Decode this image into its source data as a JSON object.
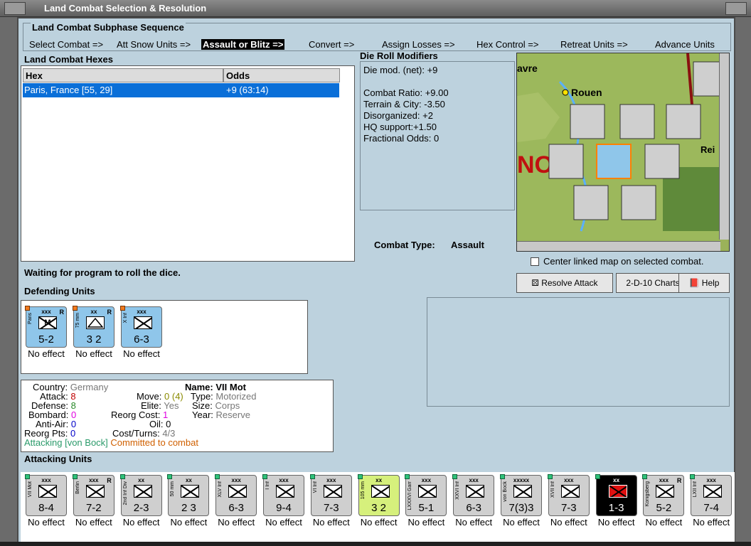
{
  "window": {
    "title": "Land Combat Selection & Resolution"
  },
  "subphase": {
    "title": "Land Combat Subphase Sequence",
    "steps": [
      "Select Combat =>",
      "Att Snow Units =>",
      "Assault or Blitz =>",
      "Convert =>",
      "Assign Losses =>",
      "Hex Control =>",
      "Retreat Units =>",
      "Advance Units"
    ],
    "active_step": "Assault or Blitz =>"
  },
  "hexes": {
    "title": "Land Combat Hexes",
    "columns": [
      "Hex",
      "Odds"
    ],
    "rows": [
      {
        "hex": "Paris, France [55, 29]",
        "odds": "+9 (63:14)"
      }
    ]
  },
  "modifiers": {
    "title": "Die Roll Modifiers",
    "lines": [
      "Die mod. (net): +9",
      "",
      "Combat Ratio: +9.00",
      "Terrain & City: -3.50",
      "Disorganized: +2",
      "HQ support:+1.50",
      "Fractional Odds: 0"
    ]
  },
  "combat_type": {
    "label": "Combat Type:",
    "value": "Assault"
  },
  "map": {
    "center_checkbox_label": "Center linked map on selected combat.",
    "labels": [
      "avre",
      "Rouen",
      "NO",
      "Rei"
    ]
  },
  "buttons": {
    "resolve": "Resolve Attack",
    "charts": "2-D-10 Charts",
    "help": "Help"
  },
  "status": "Waiting for program to roll the dice.",
  "defending": {
    "title": "Defending Units",
    "units": [
      {
        "size": "xxx",
        "name": "Paris",
        "symbol": "M",
        "value": "5-2",
        "effect": "No effect",
        "r": "R",
        "color": "blue"
      },
      {
        "size": "xx",
        "name": "75 mm",
        "symbol": "art",
        "value": "3 2",
        "effect": "No effect",
        "r": "R",
        "color": "blue"
      },
      {
        "size": "xxx",
        "name": "X Inf",
        "symbol": "inf",
        "value": "6-3",
        "effect": "No effect",
        "r": "",
        "color": "blue"
      }
    ]
  },
  "info": {
    "country_label": "Country:",
    "country": "Germany",
    "attack_label": "Attack:",
    "attack": "8",
    "defense_label": "Defense:",
    "defense": "8",
    "bombard_label": "Bombard:",
    "bombard": "0",
    "antiair_label": "Anti-Air:",
    "antiair": "0",
    "reorgpts_label": "Reorg Pts:",
    "reorgpts": "0",
    "move_label": "Move:",
    "move": "0 (4)",
    "elite_label": "Elite:",
    "elite": "Yes",
    "reorgcost_label": "Reorg Cost:",
    "reorgcost": "1",
    "oil_label": "Oil:",
    "oil": "0",
    "costturns_label": "Cost/Turns:",
    "costturns": "4/3",
    "name_label": "Name:",
    "name": "VII Mot",
    "type_label": "Type:",
    "type": "Motorized",
    "size_label": "Size:",
    "size": "Corps",
    "year_label": "Year:",
    "year": "Reserve",
    "attacking": "Attacking [von Bock]",
    "committed": "Committed to combat"
  },
  "attacking": {
    "title": "Attacking Units",
    "units": [
      {
        "size": "xxx",
        "name": "VII Mot",
        "value": "8-4",
        "effect": "No effect",
        "color": "gray",
        "r": ""
      },
      {
        "size": "xxx",
        "name": "Berlin",
        "value": "7-2",
        "effect": "No effect",
        "color": "gray",
        "r": "R"
      },
      {
        "size": "xx",
        "name": "2nd Inf Div",
        "value": "2-3",
        "effect": "No effect",
        "color": "gray",
        "r": ""
      },
      {
        "size": "xx",
        "name": "50 mm",
        "value": "2 3",
        "effect": "No effect",
        "color": "gray",
        "r": ""
      },
      {
        "size": "xxx",
        "name": "XLV Inf",
        "value": "6-3",
        "effect": "No effect",
        "color": "gray",
        "r": ""
      },
      {
        "size": "xxx",
        "name": "I Inf",
        "value": "9-4",
        "effect": "No effect",
        "color": "gray",
        "r": ""
      },
      {
        "size": "xxx",
        "name": "VI Inf",
        "value": "7-3",
        "effect": "No effect",
        "color": "gray",
        "r": ""
      },
      {
        "size": "xx",
        "name": "105 mm",
        "value": "3 2",
        "effect": "No effect",
        "color": "lime",
        "r": ""
      },
      {
        "size": "xxx",
        "name": "LXXXVI Garr",
        "value": "5-1",
        "effect": "No effect",
        "color": "gray",
        "r": ""
      },
      {
        "size": "xxx",
        "name": "XXVI Inf",
        "value": "6-3",
        "effect": "No effect",
        "color": "gray",
        "r": ""
      },
      {
        "size": "xxxxx",
        "name": "von Bock",
        "value": "7(3)3",
        "effect": "No effect",
        "color": "gray",
        "r": ""
      },
      {
        "size": "xxx",
        "name": "XVII Inf",
        "value": "7-3",
        "effect": "No effect",
        "color": "gray",
        "r": ""
      },
      {
        "size": "xx",
        "name": "Leib SS Inf D.",
        "value": "1-3",
        "effect": "No effect",
        "color": "red",
        "r": ""
      },
      {
        "size": "xxx",
        "name": "Konigsberg",
        "value": "5-2",
        "effect": "No effect",
        "color": "gray",
        "r": "R"
      },
      {
        "size": "xxx",
        "name": "LXII Inf",
        "value": "7-4",
        "effect": "No effect",
        "color": "gray",
        "r": ""
      }
    ]
  }
}
